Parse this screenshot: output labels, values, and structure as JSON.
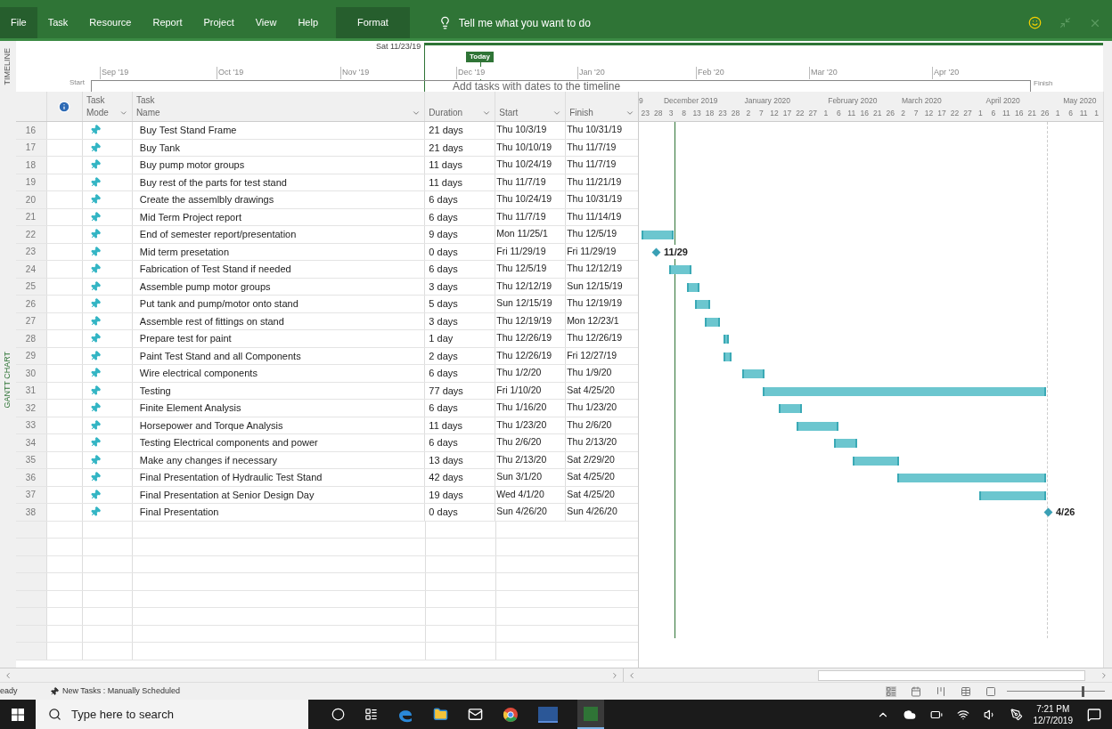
{
  "ribbon": {
    "tabs": [
      {
        "label": "File",
        "kind": "file"
      },
      {
        "label": "Task",
        "kind": "tab"
      },
      {
        "label": "Resource",
        "kind": "tab"
      },
      {
        "label": "Report",
        "kind": "tab"
      },
      {
        "label": "Project",
        "kind": "tab"
      },
      {
        "label": "View",
        "kind": "tab"
      },
      {
        "label": "Help",
        "kind": "tab"
      },
      {
        "label": "Format",
        "kind": "contextual"
      }
    ],
    "tell_me": {
      "placeholder": "Tell me what you want to do"
    }
  },
  "timeline": {
    "label": "TIMELINE",
    "current_date": "Sat 11/23/19",
    "today": "Today",
    "start": "Start",
    "finish": "Finish",
    "hint": "Add tasks with dates to the timeline",
    "months": [
      "Sep '19",
      "Oct '19",
      "Nov '19",
      "Dec '19",
      "Jan '20",
      "Feb '20",
      "Mar '20",
      "Apr '20"
    ]
  },
  "side_label": "GANTT CHART",
  "table": {
    "columns": [
      {
        "label": "Task Mode",
        "kind": "mode"
      },
      {
        "label": "Task Name",
        "kind": "name"
      },
      {
        "label": "Duration",
        "kind": "duration"
      },
      {
        "label": "Start",
        "kind": "start"
      },
      {
        "label": "Finish",
        "kind": "finish"
      }
    ],
    "rows": [
      {
        "number": "16",
        "name": "Buy Test Stand Frame",
        "duration": "21 days",
        "start": "Thu 10/3/19",
        "finish": "Thu 10/31/19",
        "kind": "none"
      },
      {
        "number": "17",
        "name": "Buy Tank",
        "duration": "21 days",
        "start": "Thu 10/10/19",
        "finish": "Thu 11/7/19",
        "kind": "none"
      },
      {
        "number": "18",
        "name": "Buy pump motor groups",
        "duration": "11 days",
        "start": "Thu 10/24/19",
        "finish": "Thu 11/7/19",
        "kind": "none"
      },
      {
        "number": "19",
        "name": "Buy rest of the parts for test stand",
        "duration": "11 days",
        "start": "Thu 11/7/19",
        "finish": "Thu 11/21/19",
        "kind": "none"
      },
      {
        "number": "20",
        "name": "Create the assemlbly drawings",
        "duration": "6 days",
        "start": "Thu 10/24/19",
        "finish": "Thu 10/31/19",
        "kind": "none"
      },
      {
        "number": "21",
        "name": "Mid Term Project report",
        "duration": "6 days",
        "start": "Thu 11/7/19",
        "finish": "Thu 11/14/19",
        "kind": "none"
      },
      {
        "number": "22",
        "name": "End of semester report/presentation",
        "duration": "9 days",
        "start": "Mon 11/25/1",
        "finish": "Thu 12/5/19",
        "kind": "bar"
      },
      {
        "number": "23",
        "name": "Mid term presetation",
        "duration": "0 days",
        "start": "Fri 11/29/19",
        "finish": "Fri 11/29/19",
        "kind": "milestone",
        "milestone_label": "11/29"
      },
      {
        "number": "24",
        "name": "Fabrication of Test Stand if needed",
        "duration": "6 days",
        "start": "Thu 12/5/19",
        "finish": "Thu 12/12/19",
        "kind": "bar"
      },
      {
        "number": "25",
        "name": "Assemble pump motor groups",
        "duration": "3 days",
        "start": "Thu 12/12/19",
        "finish": "Sun 12/15/19",
        "kind": "bar"
      },
      {
        "number": "26",
        "name": "Put tank and pump/motor onto stand",
        "duration": "5 days",
        "start": "Sun 12/15/19",
        "finish": "Thu 12/19/19",
        "kind": "bar"
      },
      {
        "number": "27",
        "name": "Assemble rest of fittings on stand",
        "duration": "3 days",
        "start": "Thu 12/19/19",
        "finish": "Mon 12/23/1",
        "kind": "bar"
      },
      {
        "number": "28",
        "name": "Prepare test for paint",
        "duration": "1 day",
        "start": "Thu 12/26/19",
        "finish": "Thu 12/26/19",
        "kind": "bar"
      },
      {
        "number": "29",
        "name": "Paint Test Stand and all Components",
        "duration": "2 days",
        "start": "Thu 12/26/19",
        "finish": "Fri 12/27/19",
        "kind": "bar"
      },
      {
        "number": "30",
        "name": "Wire electrical components",
        "duration": "6 days",
        "start": "Thu 1/2/20",
        "finish": "Thu 1/9/20",
        "kind": "bar"
      },
      {
        "number": "31",
        "name": "Testing",
        "duration": "77 days",
        "start": "Fri 1/10/20",
        "finish": "Sat 4/25/20",
        "kind": "bar"
      },
      {
        "number": "32",
        "name": "Finite Element Analysis",
        "duration": "6 days",
        "start": "Thu 1/16/20",
        "finish": "Thu 1/23/20",
        "kind": "bar"
      },
      {
        "number": "33",
        "name": "Horsepower and Torque Analysis",
        "duration": "11 days",
        "start": "Thu 1/23/20",
        "finish": "Thu 2/6/20",
        "kind": "bar"
      },
      {
        "number": "34",
        "name": "Testing Electrical components and power",
        "duration": "6 days",
        "start": "Thu 2/6/20",
        "finish": "Thu 2/13/20",
        "kind": "bar"
      },
      {
        "number": "35",
        "name": "Make any changes if necessary",
        "duration": "13 days",
        "start": "Thu 2/13/20",
        "finish": "Sat 2/29/20",
        "kind": "bar"
      },
      {
        "number": "36",
        "name": "Final Presentation of Hydraulic Test Stand",
        "duration": "42 days",
        "start": "Sun 3/1/20",
        "finish": "Sat 4/25/20",
        "kind": "bar"
      },
      {
        "number": "37",
        "name": "Final Presentation at Senior Design Day",
        "duration": "19 days",
        "start": "Wed 4/1/20",
        "finish": "Sat 4/25/20",
        "kind": "bar"
      },
      {
        "number": "38",
        "name": "Final Presentation",
        "duration": "0 days",
        "start": "Sun 4/26/20",
        "finish": "Sun 4/26/20",
        "kind": "milestone",
        "milestone_label": "4/26"
      }
    ]
  },
  "gantt": {
    "months": [
      "9",
      "December 2019",
      "January 2020",
      "February 2020",
      "March 2020",
      "April 2020",
      "May 2020"
    ],
    "days": [
      "23",
      "28",
      "3",
      "8",
      "13",
      "18",
      "23",
      "28",
      "2",
      "7",
      "12",
      "17",
      "22",
      "27",
      "1",
      "6",
      "11",
      "16",
      "21",
      "26",
      "2",
      "7",
      "12",
      "17",
      "22",
      "27",
      "1",
      "6",
      "11",
      "16",
      "21",
      "26",
      "1",
      "6",
      "11",
      "1"
    ]
  },
  "status_bar": {
    "state": "eady",
    "new_tasks": "New Tasks : Manually Scheduled",
    "zoom": {
      "level": 0.76
    }
  },
  "taskbar": {
    "search": {
      "placeholder": "Type here to search"
    },
    "time": "7:21 PM",
    "date": "12/7/2019"
  }
}
